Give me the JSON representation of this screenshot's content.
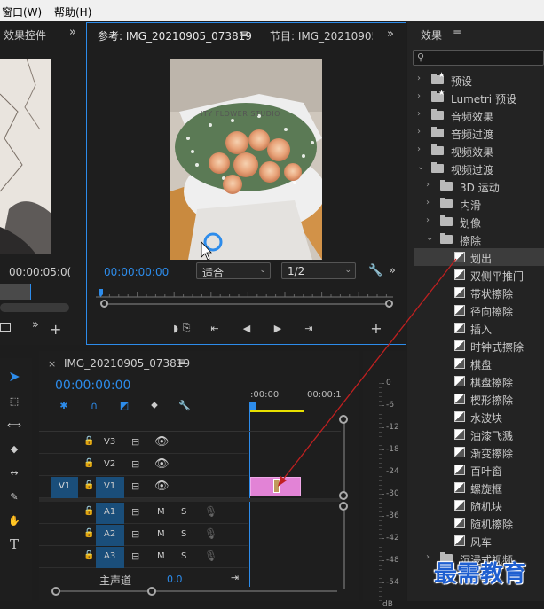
{
  "menu": {
    "window": "窗口(W)",
    "help": "帮助(H)"
  },
  "effect_controls": {
    "tab": "效果控件",
    "timecode": "00:00:05:0("
  },
  "source_monitor": {
    "tab_active": "参考: IMG_20210905_073819",
    "tab_program": "节目: IMG_20210905_",
    "timecode": "00:00:00:00",
    "fit_select": "适合",
    "resolution_select": "1/2",
    "image_text": "ITY FLOWER STUDIO"
  },
  "timeline": {
    "sequence_name": "IMG_20210905_073819",
    "timecode": "00:00:00:00",
    "ruler_labels": [
      ":00:00",
      "00:00:1"
    ],
    "video_tracks": [
      {
        "name": "V3",
        "target": ""
      },
      {
        "name": "V2",
        "target": ""
      },
      {
        "name": "V1",
        "target": "V1"
      }
    ],
    "audio_tracks": [
      {
        "name": "A1",
        "m": "M",
        "s": "S"
      },
      {
        "name": "A2",
        "m": "M",
        "s": "S"
      },
      {
        "name": "A3",
        "m": "M",
        "s": "S"
      }
    ],
    "master_label": "主声道",
    "master_value": "0.0"
  },
  "audio_meter": {
    "ticks": [
      "0",
      "-6",
      "-12",
      "-18",
      "-24",
      "-30",
      "-36",
      "-42",
      "-48",
      "-54",
      "dB"
    ]
  },
  "effects_panel": {
    "title": "效果",
    "search_placeholder": "",
    "items": [
      {
        "label": "预设",
        "level": 0,
        "open": false,
        "type": "star-folder"
      },
      {
        "label": "Lumetri 预设",
        "level": 0,
        "open": false,
        "type": "star-folder"
      },
      {
        "label": "音频效果",
        "level": 0,
        "open": false,
        "type": "folder"
      },
      {
        "label": "音频过渡",
        "level": 0,
        "open": false,
        "type": "folder"
      },
      {
        "label": "视频效果",
        "level": 0,
        "open": false,
        "type": "folder"
      },
      {
        "label": "视频过渡",
        "level": 0,
        "open": true,
        "type": "folder"
      },
      {
        "label": "3D 运动",
        "level": 1,
        "open": false,
        "type": "folder"
      },
      {
        "label": "内滑",
        "level": 1,
        "open": false,
        "type": "folder"
      },
      {
        "label": "划像",
        "level": 1,
        "open": false,
        "type": "folder"
      },
      {
        "label": "擦除",
        "level": 1,
        "open": true,
        "type": "folder"
      },
      {
        "label": "划出",
        "level": 2,
        "type": "transition",
        "selected": true
      },
      {
        "label": "双侧平推门",
        "level": 2,
        "type": "transition"
      },
      {
        "label": "带状擦除",
        "level": 2,
        "type": "transition"
      },
      {
        "label": "径向擦除",
        "level": 2,
        "type": "transition"
      },
      {
        "label": "插入",
        "level": 2,
        "type": "transition"
      },
      {
        "label": "时钟式擦除",
        "level": 2,
        "type": "transition"
      },
      {
        "label": "棋盘",
        "level": 2,
        "type": "transition"
      },
      {
        "label": "棋盘擦除",
        "level": 2,
        "type": "transition"
      },
      {
        "label": "楔形擦除",
        "level": 2,
        "type": "transition"
      },
      {
        "label": "水波块",
        "level": 2,
        "type": "transition"
      },
      {
        "label": "油漆飞溅",
        "level": 2,
        "type": "transition"
      },
      {
        "label": "渐变擦除",
        "level": 2,
        "type": "transition"
      },
      {
        "label": "百叶窗",
        "level": 2,
        "type": "transition"
      },
      {
        "label": "螺旋框",
        "level": 2,
        "type": "transition"
      },
      {
        "label": "随机块",
        "level": 2,
        "type": "transition"
      },
      {
        "label": "随机擦除",
        "level": 2,
        "type": "transition"
      },
      {
        "label": "风车",
        "level": 2,
        "type": "transition"
      },
      {
        "label": "沉浸式视频",
        "level": 1,
        "open": false,
        "type": "folder"
      }
    ]
  },
  "watermark": "最需教育"
}
